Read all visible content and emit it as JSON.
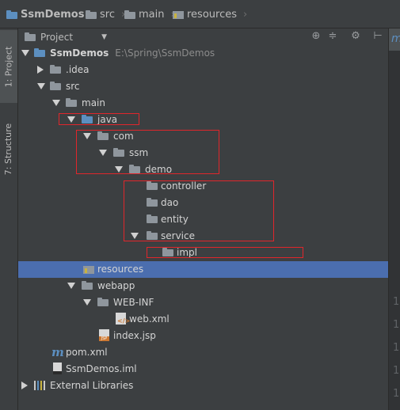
{
  "breadcrumb": {
    "items": [
      {
        "label": "SsmDemos",
        "icon": "module-folder-icon"
      },
      {
        "label": "src",
        "icon": "folder-icon"
      },
      {
        "label": "main",
        "icon": "folder-icon"
      },
      {
        "label": "resources",
        "icon": "resources-folder-icon"
      }
    ]
  },
  "left_strip": {
    "project_tab": "1: Project",
    "structure_tab": "7: Structure"
  },
  "panel": {
    "view_selector": "Project",
    "tools": [
      "target-icon",
      "collapse-all-icon",
      "settings-icon",
      "hide-panel-icon"
    ]
  },
  "tree": {
    "root": {
      "label": "SsmDemos",
      "path": "E:\\Spring\\SsmDemos"
    },
    "idea": ".idea",
    "src": "src",
    "main": "main",
    "java": "java",
    "com": "com",
    "ssm": "ssm",
    "demo": "demo",
    "controller": "controller",
    "dao": "dao",
    "entity": "entity",
    "service": "service",
    "impl": "impl",
    "resources": "resources",
    "webapp": "webapp",
    "webinf": "WEB-INF",
    "webxml": "web.xml",
    "indexjsp": "index.jsp",
    "pom": "pom.xml",
    "iml": "SsmDemos.iml",
    "external": "External Libraries",
    "selected": "resources"
  },
  "editor_gutter": {
    "line_numbers": [
      "1",
      "1",
      "1",
      "1",
      "1"
    ]
  },
  "colors": {
    "background": "#3c3f41",
    "selection": "#4b6eaf",
    "annotation_box": "#e0262b",
    "folder_blue": "#5c8fc0"
  }
}
